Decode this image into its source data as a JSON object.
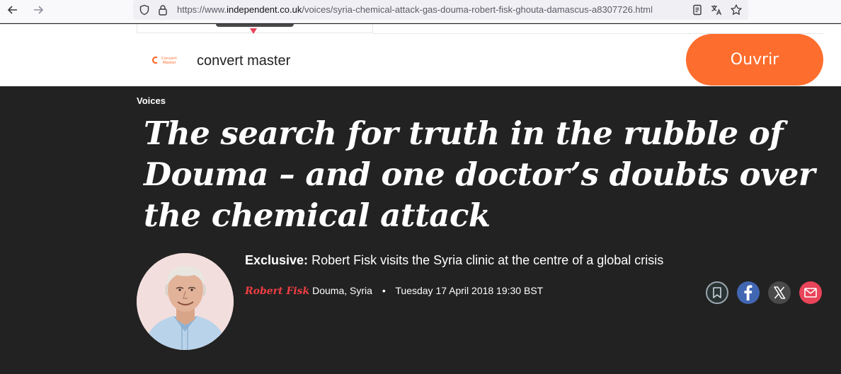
{
  "browser": {
    "url_prefix": "https://www.",
    "url_domain": "independent.co.uk",
    "url_path": "/voices/syria-chemical-attack-gas-douma-robert-fisk-ghouta-damascus-a8307726.html",
    "back_icon": "back-arrow-icon",
    "forward_icon": "forward-arrow-icon"
  },
  "ad": {
    "logo_text_1": "Convert",
    "logo_text_2": "Master",
    "name": "convert master",
    "button_label": "Ouvrir",
    "button_color": "#fd6d2d"
  },
  "article": {
    "section": "Voices",
    "headline_line1": "The search for truth in the rubble of",
    "headline_line2": "Douma – and one doctor’s doubts over",
    "headline_line3": "the chemical attack",
    "standfirst_bold": "Exclusive:",
    "standfirst_text": " Robert Fisk visits the Syria clinic at the centre of a global crisis",
    "author": "Robert Fisk",
    "location": "Douma, Syria",
    "separator": "•",
    "date": "Tuesday 17 April 2018 19:30 BST",
    "author_color": "#ef3e42",
    "background_color": "#222222"
  },
  "share": {
    "icons": [
      "bookmark-icon",
      "facebook-icon",
      "x-icon",
      "mail-icon"
    ]
  }
}
